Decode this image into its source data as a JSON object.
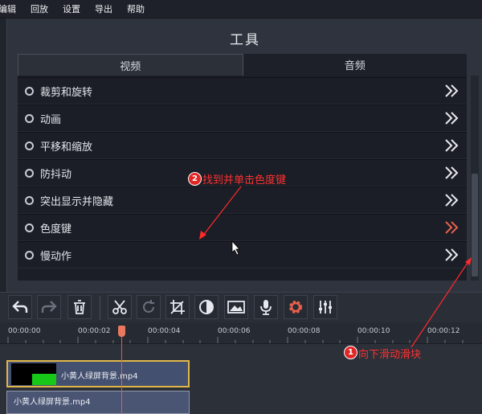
{
  "menu": [
    "编辑",
    "回放",
    "设置",
    "导出",
    "帮助"
  ],
  "panel": {
    "title": "工具"
  },
  "tabs": [
    {
      "label": "视频",
      "active": true
    },
    {
      "label": "音频",
      "active": false
    }
  ],
  "tools": [
    {
      "label": "裁剪和旋转",
      "highlight": false
    },
    {
      "label": "动画",
      "highlight": false
    },
    {
      "label": "平移和缩放",
      "highlight": false
    },
    {
      "label": "防抖动",
      "highlight": false
    },
    {
      "label": "突出显示并隐藏",
      "highlight": false
    },
    {
      "label": "色度键",
      "highlight": true
    },
    {
      "label": "慢动作",
      "highlight": false
    }
  ],
  "toolbar": {
    "icons": [
      "undo-icon",
      "redo-icon",
      "trash-icon",
      "scissors-icon",
      "rotate-icon",
      "crop-icon",
      "color-adjust-icon",
      "image-icon",
      "microphone-icon",
      "gear-icon",
      "equalizer-icon"
    ]
  },
  "ruler": {
    "ticks": [
      "00:00:00",
      "00:00:02",
      "00:00:04",
      "00:00:06",
      "00:00:08",
      "00:00:10",
      "00:00:12"
    ]
  },
  "clips": [
    {
      "name": "小黄人绿屏背景.mp4"
    },
    {
      "name": "小黄人绿屏背景.mp4"
    }
  ],
  "annotations": {
    "step1": {
      "num": "1",
      "text": "向下滑动滑块"
    },
    "step2": {
      "num": "2",
      "text": "找到并单击色度键"
    }
  },
  "colors": {
    "accent_red": "#e12626",
    "highlight_chevron": "#e8604c",
    "clip_border": "#e2b74a",
    "chroma_green": "#18c818"
  }
}
